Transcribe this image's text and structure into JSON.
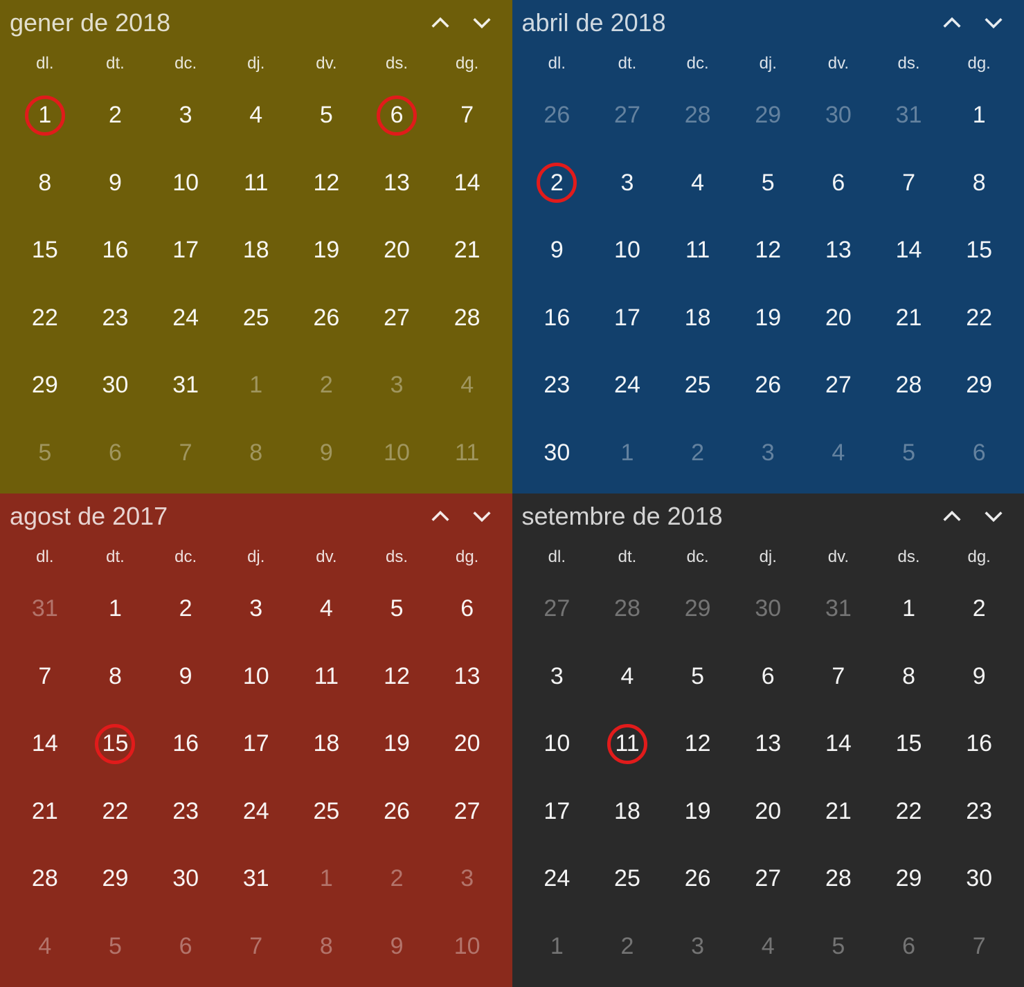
{
  "dayHeaders": [
    "dl.",
    "dt.",
    "dc.",
    "dj.",
    "dv.",
    "ds.",
    "dg."
  ],
  "panels": [
    {
      "id": "gener-2018",
      "bg": "#6e5e0a",
      "title": "gener de 2018",
      "circled": [
        1,
        6
      ],
      "days": [
        {
          "n": 1,
          "o": false
        },
        {
          "n": 2,
          "o": false
        },
        {
          "n": 3,
          "o": false
        },
        {
          "n": 4,
          "o": false
        },
        {
          "n": 5,
          "o": false
        },
        {
          "n": 6,
          "o": false
        },
        {
          "n": 7,
          "o": false
        },
        {
          "n": 8,
          "o": false
        },
        {
          "n": 9,
          "o": false
        },
        {
          "n": 10,
          "o": false
        },
        {
          "n": 11,
          "o": false
        },
        {
          "n": 12,
          "o": false
        },
        {
          "n": 13,
          "o": false
        },
        {
          "n": 14,
          "o": false
        },
        {
          "n": 15,
          "o": false
        },
        {
          "n": 16,
          "o": false
        },
        {
          "n": 17,
          "o": false
        },
        {
          "n": 18,
          "o": false
        },
        {
          "n": 19,
          "o": false
        },
        {
          "n": 20,
          "o": false
        },
        {
          "n": 21,
          "o": false
        },
        {
          "n": 22,
          "o": false
        },
        {
          "n": 23,
          "o": false
        },
        {
          "n": 24,
          "o": false
        },
        {
          "n": 25,
          "o": false
        },
        {
          "n": 26,
          "o": false
        },
        {
          "n": 27,
          "o": false
        },
        {
          "n": 28,
          "o": false
        },
        {
          "n": 29,
          "o": false
        },
        {
          "n": 30,
          "o": false
        },
        {
          "n": 31,
          "o": false
        },
        {
          "n": 1,
          "o": true
        },
        {
          "n": 2,
          "o": true
        },
        {
          "n": 3,
          "o": true
        },
        {
          "n": 4,
          "o": true
        },
        {
          "n": 5,
          "o": true
        },
        {
          "n": 6,
          "o": true
        },
        {
          "n": 7,
          "o": true
        },
        {
          "n": 8,
          "o": true
        },
        {
          "n": 9,
          "o": true
        },
        {
          "n": 10,
          "o": true
        },
        {
          "n": 11,
          "o": true
        }
      ]
    },
    {
      "id": "abril-2018",
      "bg": "#12406c",
      "title": "abril de 2018",
      "circled": [
        2
      ],
      "days": [
        {
          "n": 26,
          "o": true
        },
        {
          "n": 27,
          "o": true
        },
        {
          "n": 28,
          "o": true
        },
        {
          "n": 29,
          "o": true
        },
        {
          "n": 30,
          "o": true
        },
        {
          "n": 31,
          "o": true
        },
        {
          "n": 1,
          "o": false
        },
        {
          "n": 2,
          "o": false
        },
        {
          "n": 3,
          "o": false
        },
        {
          "n": 4,
          "o": false
        },
        {
          "n": 5,
          "o": false
        },
        {
          "n": 6,
          "o": false
        },
        {
          "n": 7,
          "o": false
        },
        {
          "n": 8,
          "o": false
        },
        {
          "n": 9,
          "o": false
        },
        {
          "n": 10,
          "o": false
        },
        {
          "n": 11,
          "o": false
        },
        {
          "n": 12,
          "o": false
        },
        {
          "n": 13,
          "o": false
        },
        {
          "n": 14,
          "o": false
        },
        {
          "n": 15,
          "o": false
        },
        {
          "n": 16,
          "o": false
        },
        {
          "n": 17,
          "o": false
        },
        {
          "n": 18,
          "o": false
        },
        {
          "n": 19,
          "o": false
        },
        {
          "n": 20,
          "o": false
        },
        {
          "n": 21,
          "o": false
        },
        {
          "n": 22,
          "o": false
        },
        {
          "n": 23,
          "o": false
        },
        {
          "n": 24,
          "o": false
        },
        {
          "n": 25,
          "o": false
        },
        {
          "n": 26,
          "o": false
        },
        {
          "n": 27,
          "o": false
        },
        {
          "n": 28,
          "o": false
        },
        {
          "n": 29,
          "o": false
        },
        {
          "n": 30,
          "o": false
        },
        {
          "n": 1,
          "o": true
        },
        {
          "n": 2,
          "o": true
        },
        {
          "n": 3,
          "o": true
        },
        {
          "n": 4,
          "o": true
        },
        {
          "n": 5,
          "o": true
        },
        {
          "n": 6,
          "o": true
        }
      ]
    },
    {
      "id": "agost-2017",
      "bg": "#8a2a1c",
      "title": "agost de 2017",
      "circled": [
        15
      ],
      "days": [
        {
          "n": 31,
          "o": true
        },
        {
          "n": 1,
          "o": false
        },
        {
          "n": 2,
          "o": false
        },
        {
          "n": 3,
          "o": false
        },
        {
          "n": 4,
          "o": false
        },
        {
          "n": 5,
          "o": false
        },
        {
          "n": 6,
          "o": false
        },
        {
          "n": 7,
          "o": false
        },
        {
          "n": 8,
          "o": false
        },
        {
          "n": 9,
          "o": false
        },
        {
          "n": 10,
          "o": false
        },
        {
          "n": 11,
          "o": false
        },
        {
          "n": 12,
          "o": false
        },
        {
          "n": 13,
          "o": false
        },
        {
          "n": 14,
          "o": false
        },
        {
          "n": 15,
          "o": false
        },
        {
          "n": 16,
          "o": false
        },
        {
          "n": 17,
          "o": false
        },
        {
          "n": 18,
          "o": false
        },
        {
          "n": 19,
          "o": false
        },
        {
          "n": 20,
          "o": false
        },
        {
          "n": 21,
          "o": false
        },
        {
          "n": 22,
          "o": false
        },
        {
          "n": 23,
          "o": false
        },
        {
          "n": 24,
          "o": false
        },
        {
          "n": 25,
          "o": false
        },
        {
          "n": 26,
          "o": false
        },
        {
          "n": 27,
          "o": false
        },
        {
          "n": 28,
          "o": false
        },
        {
          "n": 29,
          "o": false
        },
        {
          "n": 30,
          "o": false
        },
        {
          "n": 31,
          "o": false
        },
        {
          "n": 1,
          "o": true
        },
        {
          "n": 2,
          "o": true
        },
        {
          "n": 3,
          "o": true
        },
        {
          "n": 4,
          "o": true
        },
        {
          "n": 5,
          "o": true
        },
        {
          "n": 6,
          "o": true
        },
        {
          "n": 7,
          "o": true
        },
        {
          "n": 8,
          "o": true
        },
        {
          "n": 9,
          "o": true
        },
        {
          "n": 10,
          "o": true
        }
      ]
    },
    {
      "id": "setembre-2018",
      "bg": "#2a2a2a",
      "title": "setembre de 2018",
      "circled": [
        11
      ],
      "days": [
        {
          "n": 27,
          "o": true
        },
        {
          "n": 28,
          "o": true
        },
        {
          "n": 29,
          "o": true
        },
        {
          "n": 30,
          "o": true
        },
        {
          "n": 31,
          "o": true
        },
        {
          "n": 1,
          "o": false
        },
        {
          "n": 2,
          "o": false
        },
        {
          "n": 3,
          "o": false
        },
        {
          "n": 4,
          "o": false
        },
        {
          "n": 5,
          "o": false
        },
        {
          "n": 6,
          "o": false
        },
        {
          "n": 7,
          "o": false
        },
        {
          "n": 8,
          "o": false
        },
        {
          "n": 9,
          "o": false
        },
        {
          "n": 10,
          "o": false
        },
        {
          "n": 11,
          "o": false
        },
        {
          "n": 12,
          "o": false
        },
        {
          "n": 13,
          "o": false
        },
        {
          "n": 14,
          "o": false
        },
        {
          "n": 15,
          "o": false
        },
        {
          "n": 16,
          "o": false
        },
        {
          "n": 17,
          "o": false
        },
        {
          "n": 18,
          "o": false
        },
        {
          "n": 19,
          "o": false
        },
        {
          "n": 20,
          "o": false
        },
        {
          "n": 21,
          "o": false
        },
        {
          "n": 22,
          "o": false
        },
        {
          "n": 23,
          "o": false
        },
        {
          "n": 24,
          "o": false
        },
        {
          "n": 25,
          "o": false
        },
        {
          "n": 26,
          "o": false
        },
        {
          "n": 27,
          "o": false
        },
        {
          "n": 28,
          "o": false
        },
        {
          "n": 29,
          "o": false
        },
        {
          "n": 30,
          "o": false
        },
        {
          "n": 1,
          "o": true
        },
        {
          "n": 2,
          "o": true
        },
        {
          "n": 3,
          "o": true
        },
        {
          "n": 4,
          "o": true
        },
        {
          "n": 5,
          "o": true
        },
        {
          "n": 6,
          "o": true
        },
        {
          "n": 7,
          "o": true
        }
      ]
    }
  ]
}
